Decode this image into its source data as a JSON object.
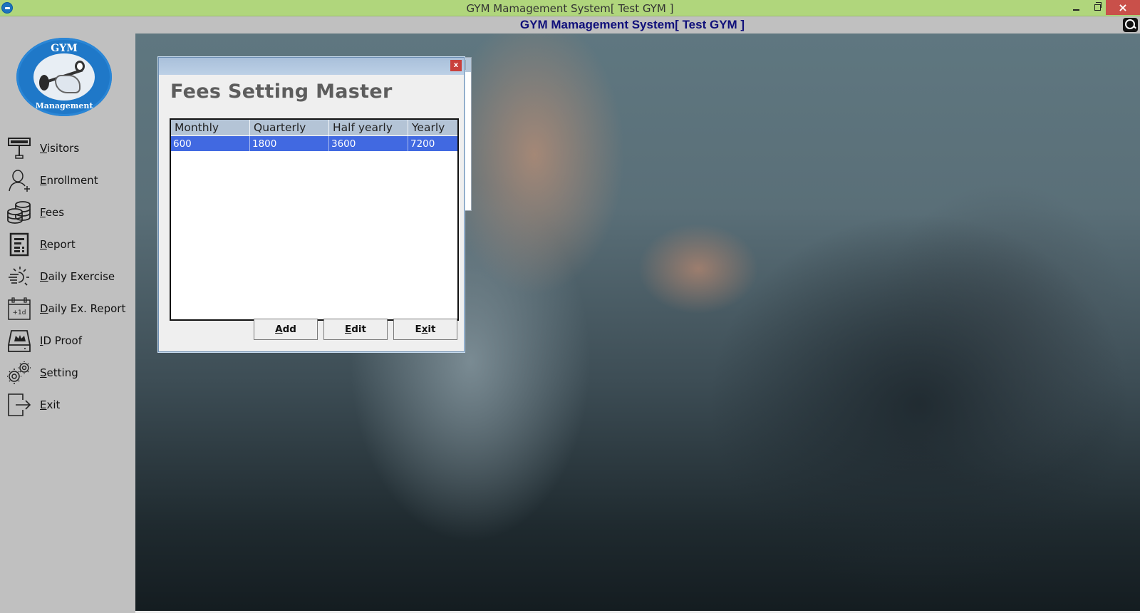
{
  "window": {
    "title": "GYM Mamagement System[ Test GYM ]",
    "controls": {
      "minimize": "minimize",
      "restore": "restore",
      "close": "×"
    }
  },
  "header": {
    "title": "GYM Mamagement System[ Test GYM ]",
    "search_icon": "search-icon"
  },
  "sidebar": {
    "logo": {
      "top_text": "GYM",
      "bottom_text": "Management"
    },
    "items": [
      {
        "label": "Visitors",
        "icon": "visitors-sign-icon"
      },
      {
        "label": "Enrollment",
        "icon": "user-add-icon"
      },
      {
        "label": "Fees",
        "icon": "coins-icon"
      },
      {
        "label": "Report",
        "icon": "report-icon"
      },
      {
        "label": "Daily Exercise",
        "icon": "sun-icon"
      },
      {
        "label": "Daily Ex. Report",
        "icon": "calendar-icon"
      },
      {
        "label": "ID Proof",
        "icon": "id-card-icon"
      },
      {
        "label": "Setting",
        "icon": "gears-icon"
      },
      {
        "label": "Exit",
        "icon": "exit-icon"
      }
    ]
  },
  "background_window": {
    "close": "x",
    "fragment": "0"
  },
  "dialog": {
    "close": "x",
    "heading": "Fees Setting Master",
    "table": {
      "columns": [
        "Monthly",
        "Quarterly",
        "Half yearly",
        "Yearly"
      ],
      "rows": [
        [
          "600",
          "1800",
          "3600",
          "7200"
        ]
      ],
      "selected_row": 0
    },
    "buttons": {
      "add": {
        "access": "A",
        "rest": "dd"
      },
      "edit": {
        "access": "E",
        "rest": "dit"
      },
      "exit": {
        "pre": "E",
        "access": "x",
        "rest": "it"
      }
    }
  },
  "colors": {
    "titlebar": "#b0d67c",
    "header_title": "#10107a",
    "selection": "#4169e1",
    "grid_header": "#b4c4d6",
    "close_red": "#c9504a"
  }
}
